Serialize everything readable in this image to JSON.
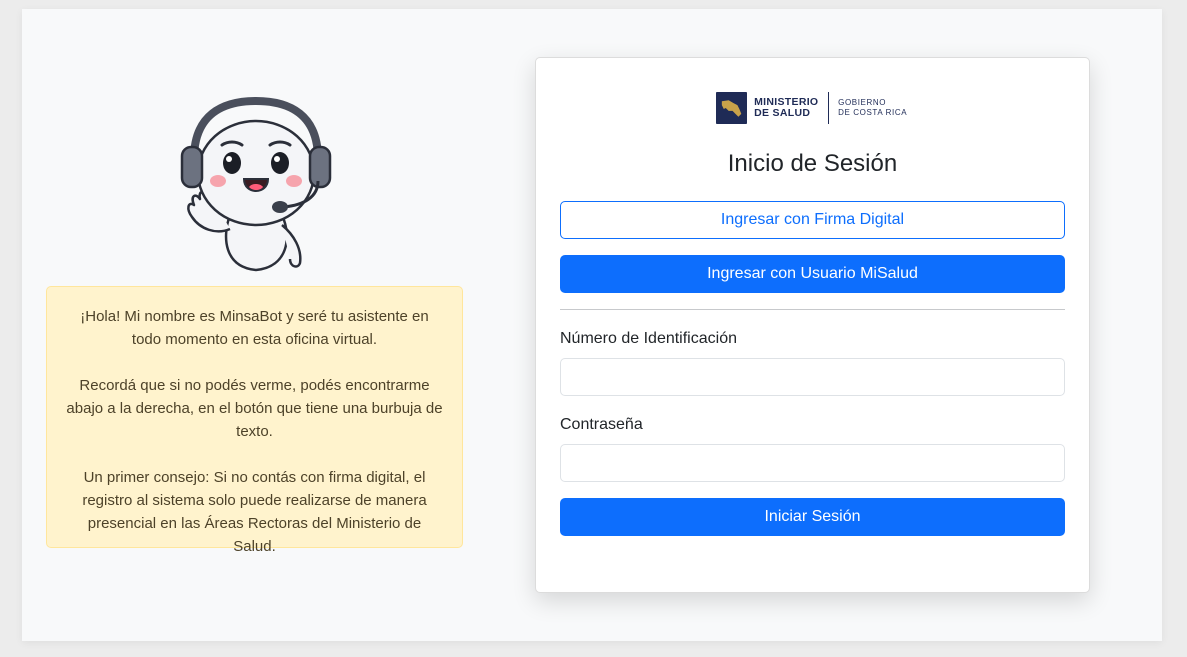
{
  "assistant": {
    "name": "MinsaBot",
    "message_paragraphs": [
      "¡Hola! Mi nombre es MinsaBot y seré tu asistente en todo momento en esta oficina virtual.",
      "Recordá que si no podés verme, podés encontrarme abajo a la derecha, en el botón que tiene una burbuja de texto.",
      "Un primer consejo: Si no contás con firma digital, el registro al sistema solo puede realizarse de manera presencial en las Áreas Rectoras del Ministerio de Salud."
    ]
  },
  "logo": {
    "line1": "MINISTERIO",
    "line2": "DE SALUD",
    "line3": "GOBIERNO",
    "line4": "DE COSTA RICA"
  },
  "login": {
    "title": "Inicio de Sesión",
    "firma_digital_button": "Ingresar con Firma Digital",
    "misalud_button": "Ingresar con Usuario MiSalud",
    "id_label": "Número de Identificación",
    "id_value": "",
    "password_label": "Contraseña",
    "password_value": "",
    "submit_button": "Iniciar Sesión"
  },
  "colors": {
    "primary": "#0d6efd",
    "brand_navy": "#1f2b56",
    "brand_gold": "#c9a24a",
    "alert_bg": "#fff3cd"
  }
}
